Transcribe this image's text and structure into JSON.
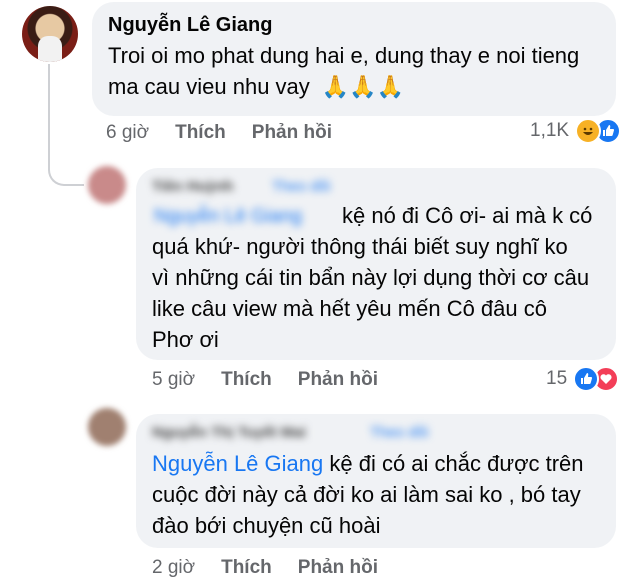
{
  "comment": {
    "author": "Nguyễn Lê Giang",
    "lines": [
      "Troi oi mo phat dung hai e, dung thay e noi tieng",
      "ma cau vieu nhu vay"
    ],
    "emoji": "🙏🙏🙏",
    "time": "6 giờ",
    "like_label": "Thích",
    "reply_label": "Phản hồi",
    "reaction_count": "1,1K",
    "reaction_icons": [
      "haha-icon",
      "like-icon"
    ]
  },
  "replies": [
    {
      "author_blurred": "Tiên Huỳnh",
      "follow_blurred": "Theo dõi",
      "mention": "Nguyễn Lê Giang",
      "lines": [
        "kệ nó đi Cô ơi- ai mà k có",
        "quá khứ- người thông thái biết suy nghĩ ko",
        "vì những cái tin bẩn này lợi dụng thời cơ câu",
        "like câu view mà hết yêu mến Cô đâu cô",
        "Phơ ơi"
      ],
      "time": "5 giờ",
      "like_label": "Thích",
      "reply_label": "Phản hồi",
      "reaction_count": "15",
      "reaction_icons": [
        "like-icon",
        "love-icon"
      ]
    },
    {
      "author_blurred": "Nguyễn Thị Tuyết Mai",
      "follow_blurred": "Theo dõi",
      "mention": "Nguyễn Lê Giang",
      "lines": [
        "kệ đi có ai chắc được trên",
        "cuộc đời này cả đời ko ai làm sai ko , bó tay",
        "đào bới chuyện cũ hoài"
      ],
      "time": "2 giờ",
      "like_label": "Thích",
      "reply_label": "Phản hồi"
    }
  ],
  "colors": {
    "bubble": "#f0f2f5",
    "link": "#1877f2",
    "meta": "#65676b",
    "like": "#1877f2",
    "love": "#f33e58",
    "haha": "#f7b125"
  }
}
